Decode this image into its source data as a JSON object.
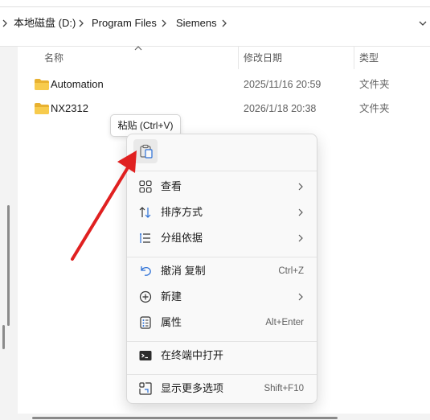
{
  "breadcrumb": {
    "items": [
      "本地磁盘 (D:)",
      "Program Files",
      "Siemens"
    ]
  },
  "columns": {
    "name": "名称",
    "date": "修改日期",
    "type": "类型"
  },
  "files": [
    {
      "name": "Automation",
      "date": "2025/11/16 20:59",
      "type": "文件夹"
    },
    {
      "name": "NX2312",
      "date": "2026/1/18 20:38",
      "type": "文件夹"
    }
  ],
  "tooltip": {
    "text": "粘贴 (Ctrl+V)"
  },
  "context_menu": {
    "paste_icon": "paste-icon",
    "items": [
      {
        "label": "查看",
        "icon": "grid-view-icon",
        "shortcut": "",
        "submenu": true
      },
      {
        "label": "排序方式",
        "icon": "sort-icon",
        "shortcut": "",
        "submenu": true
      },
      {
        "label": "分组依据",
        "icon": "group-list-icon",
        "shortcut": "",
        "submenu": true
      },
      {
        "label": "撤消 复制",
        "icon": "undo-icon",
        "shortcut": "Ctrl+Z",
        "submenu": false
      },
      {
        "label": "新建",
        "icon": "new-plus-icon",
        "shortcut": "",
        "submenu": true
      },
      {
        "label": "属性",
        "icon": "properties-icon",
        "shortcut": "Alt+Enter",
        "submenu": false
      },
      {
        "label": "在终端中打开",
        "icon": "terminal-icon",
        "shortcut": "",
        "submenu": false
      },
      {
        "label": "显示更多选项",
        "icon": "more-options-icon",
        "shortcut": "Shift+F10",
        "submenu": false
      }
    ]
  },
  "colors": {
    "folder_yellow": "#f4c542",
    "annotation_arrow": "#e02020",
    "icon_accent": "#2b6fd6"
  }
}
